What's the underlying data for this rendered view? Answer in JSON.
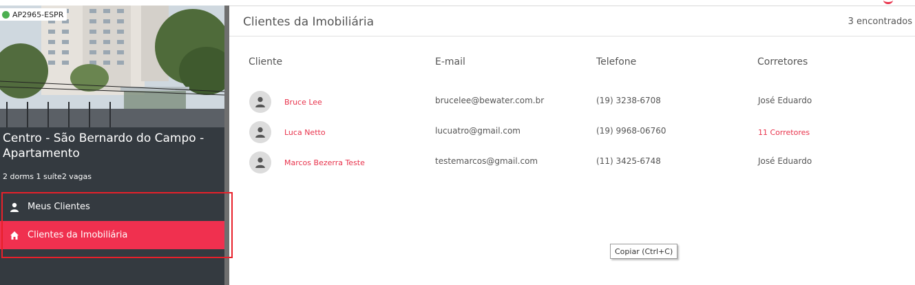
{
  "property": {
    "ref_code": "AP2965-ESPR",
    "status_color": "#4caf50",
    "title": "Centro - São Bernardo do Campo - Apartamento",
    "features": "2 dorms 1 suíte2 vagas"
  },
  "nav": {
    "items": [
      {
        "label": "Meus Clientes",
        "icon": "user-icon",
        "active": false
      },
      {
        "label": "Clientes da Imobiliária",
        "icon": "home-icon",
        "active": true
      }
    ]
  },
  "main": {
    "title": "Clientes da Imobiliária",
    "count": "3 encontrados",
    "columns": [
      "Cliente",
      "E-mail",
      "Telefone",
      "Corretores"
    ],
    "rows": [
      {
        "name": "Bruce Lee",
        "email": "brucelee@bewater.com.br",
        "phone": "(19) 3238-6708",
        "broker": "José Eduardo"
      },
      {
        "name": "Luca Netto",
        "email": "lucuatro@gmail.com",
        "phone": "(19) 9968-06760",
        "broker": "11 Corretores"
      },
      {
        "name": "Marcos Bezerra Teste",
        "email": "testemarcos@gmail.com",
        "phone": "(11) 3425-6748",
        "broker": "José Eduardo"
      }
    ]
  },
  "tooltip": {
    "text": "Copiar (Ctrl+C)"
  },
  "colors": {
    "accent": "#f0304f",
    "sidebar": "#343a40",
    "link": "#e8324b"
  }
}
